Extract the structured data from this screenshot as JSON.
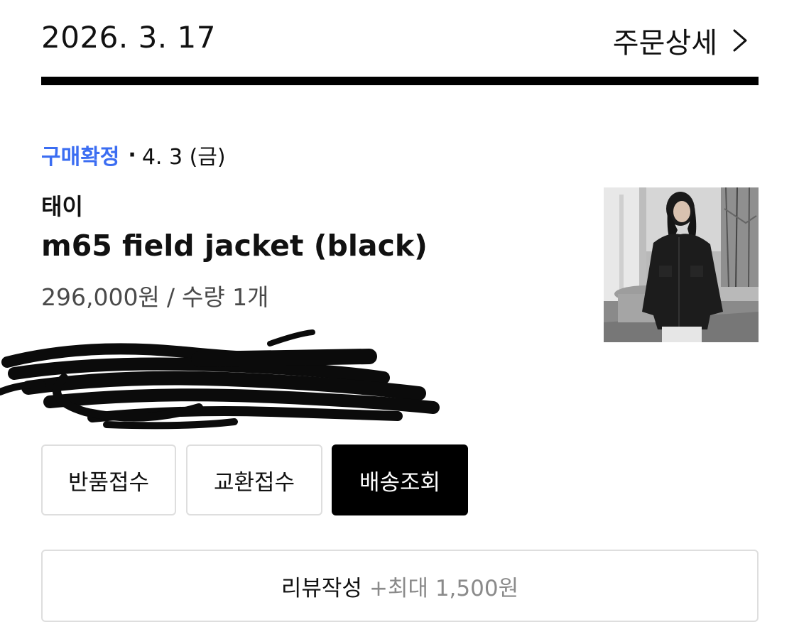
{
  "header": {
    "order_date": "2026. 3. 17",
    "detail_link": "주문상세"
  },
  "order": {
    "status": "구매확정",
    "status_separator": "·",
    "status_date": "4. 3 (금)",
    "brand": "태이",
    "product_name": "m65 field jacket (black)",
    "price": "296,000원",
    "price_separator": "/",
    "quantity": "수량 1개"
  },
  "actions": {
    "return_label": "반품접수",
    "exchange_label": "교환접수",
    "tracking_label": "배송조회"
  },
  "review": {
    "label": "리뷰작성",
    "reward": "+최대 1,500원"
  },
  "colors": {
    "status_accent": "#3b6df2",
    "primary_button": "#000000",
    "border": "#dedede"
  },
  "icons": {
    "detail": "chevron-right-icon"
  }
}
